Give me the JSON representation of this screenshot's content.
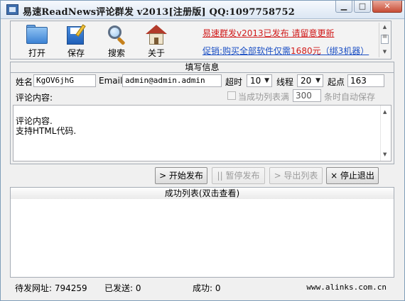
{
  "window": {
    "title": "易速ReadNews评论群发 v2013[注册版] QQ:1097758752",
    "min": "▁",
    "max": "□",
    "close": "✕"
  },
  "toolbar": {
    "open_label": "打开",
    "save_label": "保存",
    "search_label": "搜索",
    "about_label": "关于"
  },
  "promo": {
    "line1": "易速群发v2013已发布 请留意更新",
    "line2_prefix": "促销:购买全部软件仅需",
    "line2_highlight": "1680元",
    "line2_suffix": "（绑3机器）"
  },
  "form": {
    "section_title": "填写信息",
    "name_label": "姓名",
    "name_value": "KgOV6jhG",
    "email_label": "Email",
    "email_value": "admin@admin.admin",
    "timeout_label": "超时",
    "timeout_value": "10",
    "threads_label": "线程",
    "threads_value": "20",
    "start_label": "起点",
    "start_value": "163",
    "comment_label": "评论内容:",
    "autosave_checked": false,
    "autosave_prefix": "当成功列表满",
    "autosave_count": "300",
    "autosave_suffix": "条时自动保存",
    "comment_text": "评论内容.\n支持HTML代码."
  },
  "buttons": {
    "start": "> 开始发布",
    "pause": "|| 暂停发布",
    "export": "> 导出列表",
    "stop": "× 停止退出"
  },
  "list": {
    "header": "成功列表(双击查看)"
  },
  "status": {
    "pending_label": "待发网址:",
    "pending_value": "794259",
    "sent_label": "已发送:",
    "sent_value": "0",
    "success_label": "成功:",
    "success_value": "0",
    "site": "www.alinks.com.cn"
  }
}
